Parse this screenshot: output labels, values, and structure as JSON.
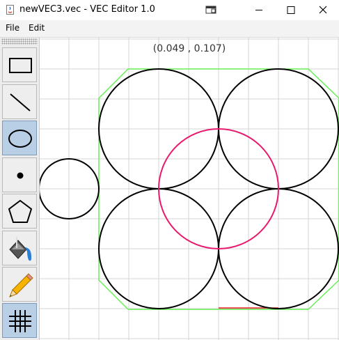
{
  "window": {
    "title": "newVEC3.vec - VEC Editor 1.0",
    "icons": [
      "java-app-icon",
      "restore-window-icon",
      "minimize-icon",
      "maximize-icon",
      "close-icon"
    ]
  },
  "menu": {
    "file_label": "File",
    "edit_label": "Edit"
  },
  "toolbar": {
    "tools": [
      {
        "name": "rectangle-tool",
        "icon": "rectangle-icon",
        "selected": false
      },
      {
        "name": "line-tool",
        "icon": "line-icon",
        "selected": false
      },
      {
        "name": "ellipse-tool",
        "icon": "ellipse-icon",
        "selected": true
      },
      {
        "name": "plot-tool",
        "icon": "dot-icon",
        "selected": false
      },
      {
        "name": "polygon-tool",
        "icon": "pentagon-icon",
        "selected": false
      },
      {
        "name": "fill-tool",
        "icon": "paint-bucket-icon",
        "selected": false
      },
      {
        "name": "pen-tool",
        "icon": "pencil-icon",
        "selected": false
      },
      {
        "name": "grid-tool",
        "icon": "grid-icon",
        "selected": true
      }
    ]
  },
  "canvas": {
    "cursor_coords": "(0.049 , 0.107)",
    "colors": {
      "grid": "#d4d4d4",
      "black_pen": "#000000",
      "pink_pen": "#e8196c",
      "green_pen": "#66ee55",
      "red_pen": "#e02020",
      "selected_tool_bg": "#b8cfe5"
    }
  }
}
